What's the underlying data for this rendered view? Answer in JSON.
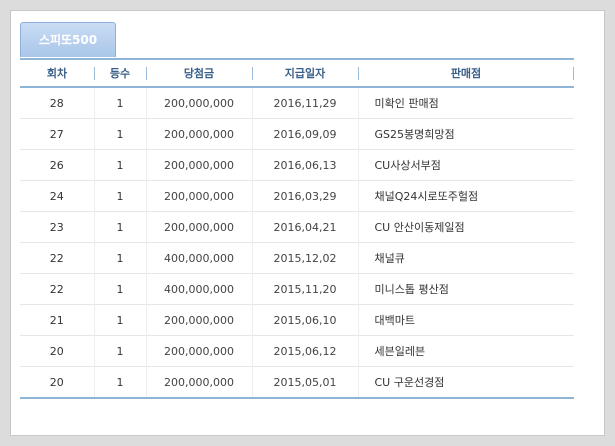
{
  "tabs": [
    {
      "label": "스피또500",
      "active": true
    }
  ],
  "table": {
    "headers": [
      "회차",
      "등수",
      "당첨금",
      "지급일자",
      "판매점"
    ],
    "rows": [
      {
        "round": "28",
        "rank": "1",
        "prize": "200,000,000",
        "date": "2016,11,29",
        "store": "미확인 판매점"
      },
      {
        "round": "27",
        "rank": "1",
        "prize": "200,000,000",
        "date": "2016,09,09",
        "store": "GS25봉명희망점"
      },
      {
        "round": "26",
        "rank": "1",
        "prize": "200,000,000",
        "date": "2016,06,13",
        "store": "CU사상서부점"
      },
      {
        "round": "24",
        "rank": "1",
        "prize": "200,000,000",
        "date": "2016,03,29",
        "store": "채널Q24시로또주헐점"
      },
      {
        "round": "23",
        "rank": "1",
        "prize": "200,000,000",
        "date": "2016,04,21",
        "store": "CU 안산이동제일점"
      },
      {
        "round": "22",
        "rank": "1",
        "prize": "400,000,000",
        "date": "2015,12,02",
        "store": "채널큐"
      },
      {
        "round": "22",
        "rank": "1",
        "prize": "400,000,000",
        "date": "2015,11,20",
        "store": "미니스톱 평산점"
      },
      {
        "round": "21",
        "rank": "1",
        "prize": "200,000,000",
        "date": "2015,06,10",
        "store": "대백마트"
      },
      {
        "round": "20",
        "rank": "1",
        "prize": "200,000,000",
        "date": "2015,06,12",
        "store": "세븐일레븐"
      },
      {
        "round": "20",
        "rank": "1",
        "prize": "200,000,000",
        "date": "2015,05,01",
        "store": "CU 구운선경점"
      }
    ]
  },
  "colors": {
    "tab_bg": "#a9c6ea",
    "header_text": "#3a5f88",
    "rule": "#8fb5d6"
  }
}
